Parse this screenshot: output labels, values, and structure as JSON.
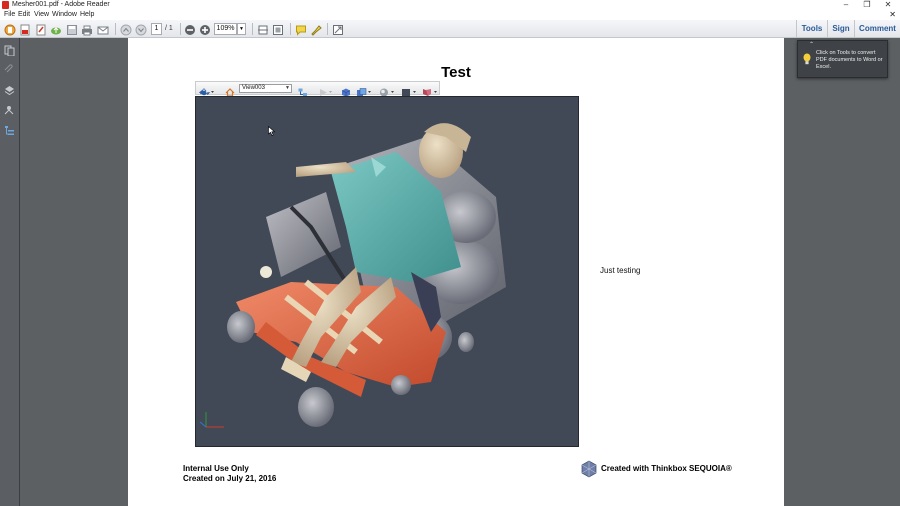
{
  "window": {
    "title": "Mesher001.pdf - Adobe Reader",
    "controls": {
      "minimize": "–",
      "restore": "❐",
      "close": "✕"
    }
  },
  "menu": {
    "items": [
      "File",
      "Edit",
      "View",
      "Window",
      "Help"
    ],
    "doc_close": "✕"
  },
  "toolbar": {
    "page_current": "1",
    "page_total": "/ 1",
    "zoom": "109%",
    "right_tabs": [
      "Tools",
      "Sign",
      "Comment"
    ]
  },
  "document": {
    "title": "Test",
    "view_select": "View003",
    "side_note": "Just testing",
    "footer_left": [
      "Internal Use Only",
      "Created on July 21, 2016"
    ],
    "footer_right": "Created with Thinkbox SEQUOIA®"
  },
  "tooltip": {
    "message": "Click on Tools to convert PDF documents to Word or Excel."
  },
  "colors": {
    "viewport_bg": "#414856",
    "accent_link": "#2a5b9a",
    "chair_frame": "#e56a48",
    "gown": "#5fb0ad",
    "skin": "#d9c2a2"
  }
}
